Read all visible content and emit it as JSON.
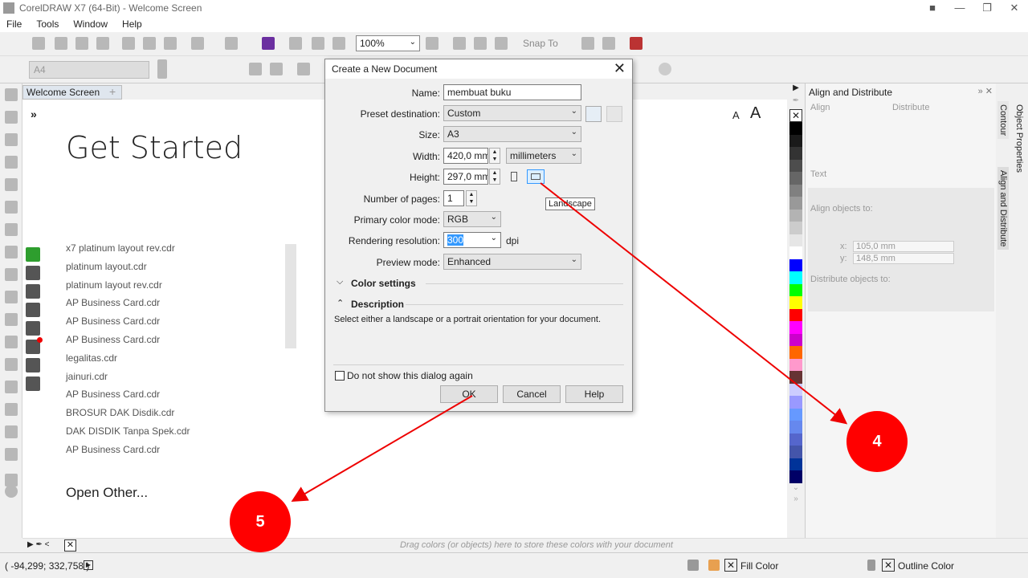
{
  "window": {
    "title": "CorelDRAW X7 (64-Bit) - Welcome Screen"
  },
  "menu": [
    "File",
    "Tools",
    "Window",
    "Help"
  ],
  "toolbar": {
    "zoom": "100%",
    "snap_to": "Snap To",
    "page_size": "A4"
  },
  "tab": {
    "label": "Welcome Screen"
  },
  "welcome": {
    "heading": "Get Started",
    "font_small": "A",
    "font_big": "A",
    "recent": [
      "x7 platinum layout rev.cdr",
      "platinum layout.cdr",
      "platinum layout rev.cdr",
      "AP Business Card.cdr",
      "AP Business Card.cdr",
      "AP Business Card.cdr",
      "legalitas.cdr",
      "jainuri.cdr",
      "AP Business Card.cdr",
      "BROSUR DAK Disdik.cdr",
      "DAK DISDIK Tanpa Spek.cdr",
      "AP Business Card.cdr"
    ],
    "open_other": "Open Other..."
  },
  "dialog": {
    "title": "Create a New Document",
    "name_label": "Name:",
    "name_value": "membuat buku",
    "preset_label": "Preset destination:",
    "preset_value": "Custom",
    "size_label": "Size:",
    "size_value": "A3",
    "width_label": "Width:",
    "width_value": "420,0 mm",
    "units_value": "millimeters",
    "height_label": "Height:",
    "height_value": "297,0 mm",
    "tooltip": "Landscape",
    "pages_label": "Number of pages:",
    "pages_value": "1",
    "color_mode_label": "Primary color mode:",
    "color_mode_value": "RGB",
    "resolution_label": "Rendering resolution:",
    "resolution_value": "300",
    "resolution_unit": "dpi",
    "preview_label": "Preview mode:",
    "preview_value": "Enhanced",
    "color_settings": "Color settings",
    "description_header": "Description",
    "description_text": "Select either a landscape or a portrait orientation for your document.",
    "dont_show": "Do not show this dialog again",
    "ok": "OK",
    "cancel": "Cancel",
    "help": "Help"
  },
  "palette_colors": [
    "#000000",
    "#1a1a1a",
    "#333333",
    "#4d4d4d",
    "#666666",
    "#808080",
    "#999999",
    "#b3b3b3",
    "#cccccc",
    "#e6e6e6",
    "#ffffff",
    "#0000ff",
    "#00ffff",
    "#00ff00",
    "#ffff00",
    "#ff0000",
    "#ff00ff",
    "#cc00cc",
    "#ff6600",
    "#ff99cc",
    "#663333",
    "#ccccff",
    "#9999ff",
    "#6699ff",
    "#6688ee",
    "#5566cc",
    "#4455aa",
    "#003399",
    "#000066"
  ],
  "docker": {
    "title": "Align and Distribute",
    "align": "Align",
    "distribute": "Distribute",
    "text": "Text",
    "align_to": "Align objects to:",
    "x_label": "x:",
    "x_value": "105,0 mm",
    "y_label": "y:",
    "y_value": "148,5 mm",
    "distribute_to": "Distribute objects to:",
    "tabs": [
      "Object Properties",
      "Contour",
      "Align and Distribute"
    ]
  },
  "document_palette_hint": "Drag colors (or objects) here to store these colors with your document",
  "status": {
    "coords": "( -94,299; 332,758 )",
    "fill": "Fill Color",
    "outline": "Outline Color"
  },
  "callouts": {
    "four": "4",
    "five": "5"
  },
  "colors": {
    "accent_red": "#ff0000",
    "selection_blue": "#3399ff"
  }
}
